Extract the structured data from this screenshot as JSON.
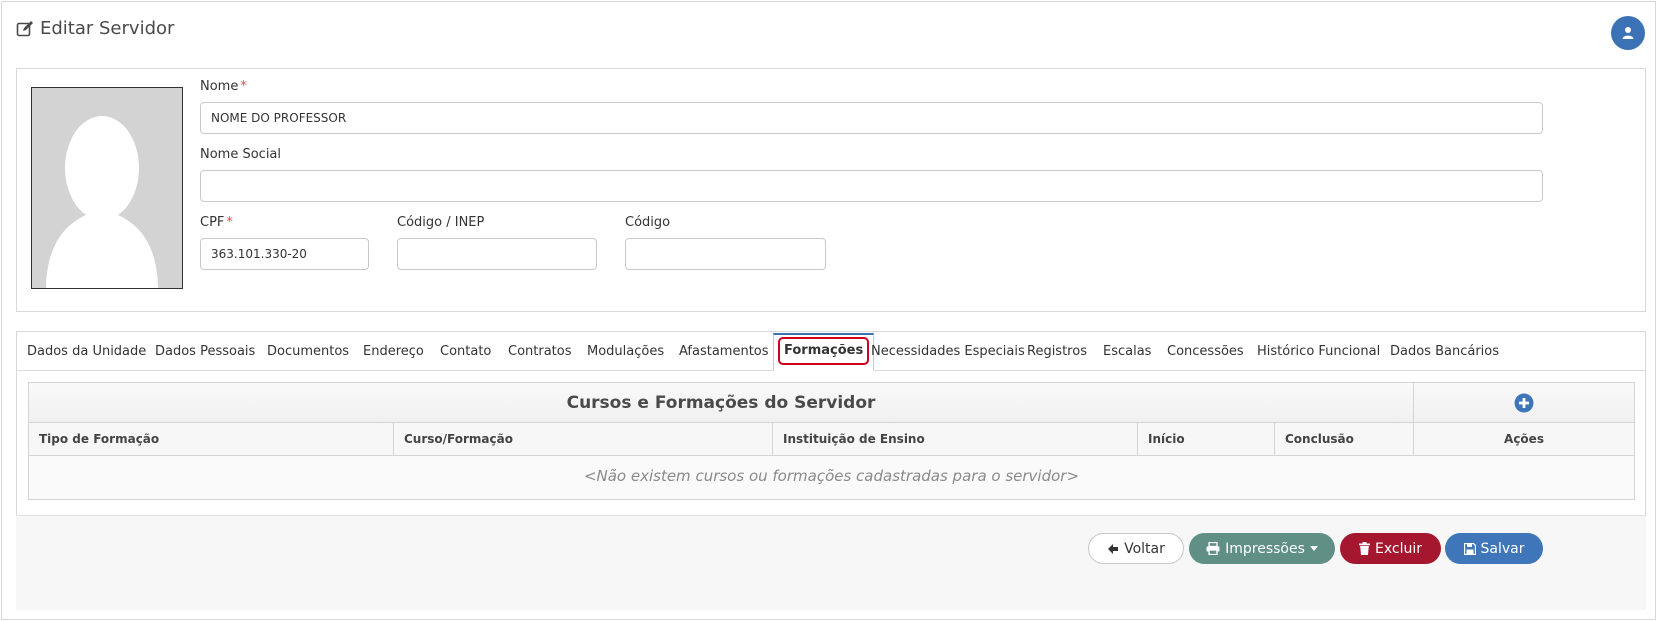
{
  "header": {
    "title": "Editar Servidor",
    "title_icon": "edit-icon",
    "user_icon": "user-icon"
  },
  "form": {
    "nome_label": "Nome",
    "nome_value": "NOME DO PROFESSOR",
    "nome_social_label": "Nome Social",
    "nome_social_value": "",
    "cpf_label": "CPF",
    "cpf_value": "363.101.330-20",
    "inep_label": "Código / INEP",
    "inep_value": "",
    "codigo_label": "Código",
    "codigo_value": "",
    "required_mark": "*"
  },
  "tabs": [
    {
      "label": "Dados da Unidade"
    },
    {
      "label": "Dados Pessoais"
    },
    {
      "label": "Documentos"
    },
    {
      "label": "Endereço"
    },
    {
      "label": "Contato"
    },
    {
      "label": "Contratos"
    },
    {
      "label": "Modulações"
    },
    {
      "label": "Afastamentos"
    },
    {
      "label": "Formações"
    },
    {
      "label": "Necessidades Especiais"
    },
    {
      "label": "Registros"
    },
    {
      "label": "Escalas"
    },
    {
      "label": "Concessões"
    },
    {
      "label": "Histórico Funcional"
    },
    {
      "label": "Dados Bancários"
    }
  ],
  "active_tab": "Formações",
  "table": {
    "title": "Cursos e Formações do Servidor",
    "add_icon": "plus-circle-icon",
    "columns": [
      "Tipo de Formação",
      "Curso/Formação",
      "Instituição de Ensino",
      "Início",
      "Conclusão",
      "Ações"
    ],
    "empty_message": "<Não existem cursos ou formações cadastradas para o servidor>"
  },
  "buttons": {
    "voltar": "Voltar",
    "impressoes": "Impressões",
    "excluir": "Excluir",
    "salvar": "Salvar"
  },
  "colors": {
    "primary": "#3f76b9",
    "print": "#5f8f85",
    "danger": "#a5172e",
    "highlight": "#d0021b"
  }
}
